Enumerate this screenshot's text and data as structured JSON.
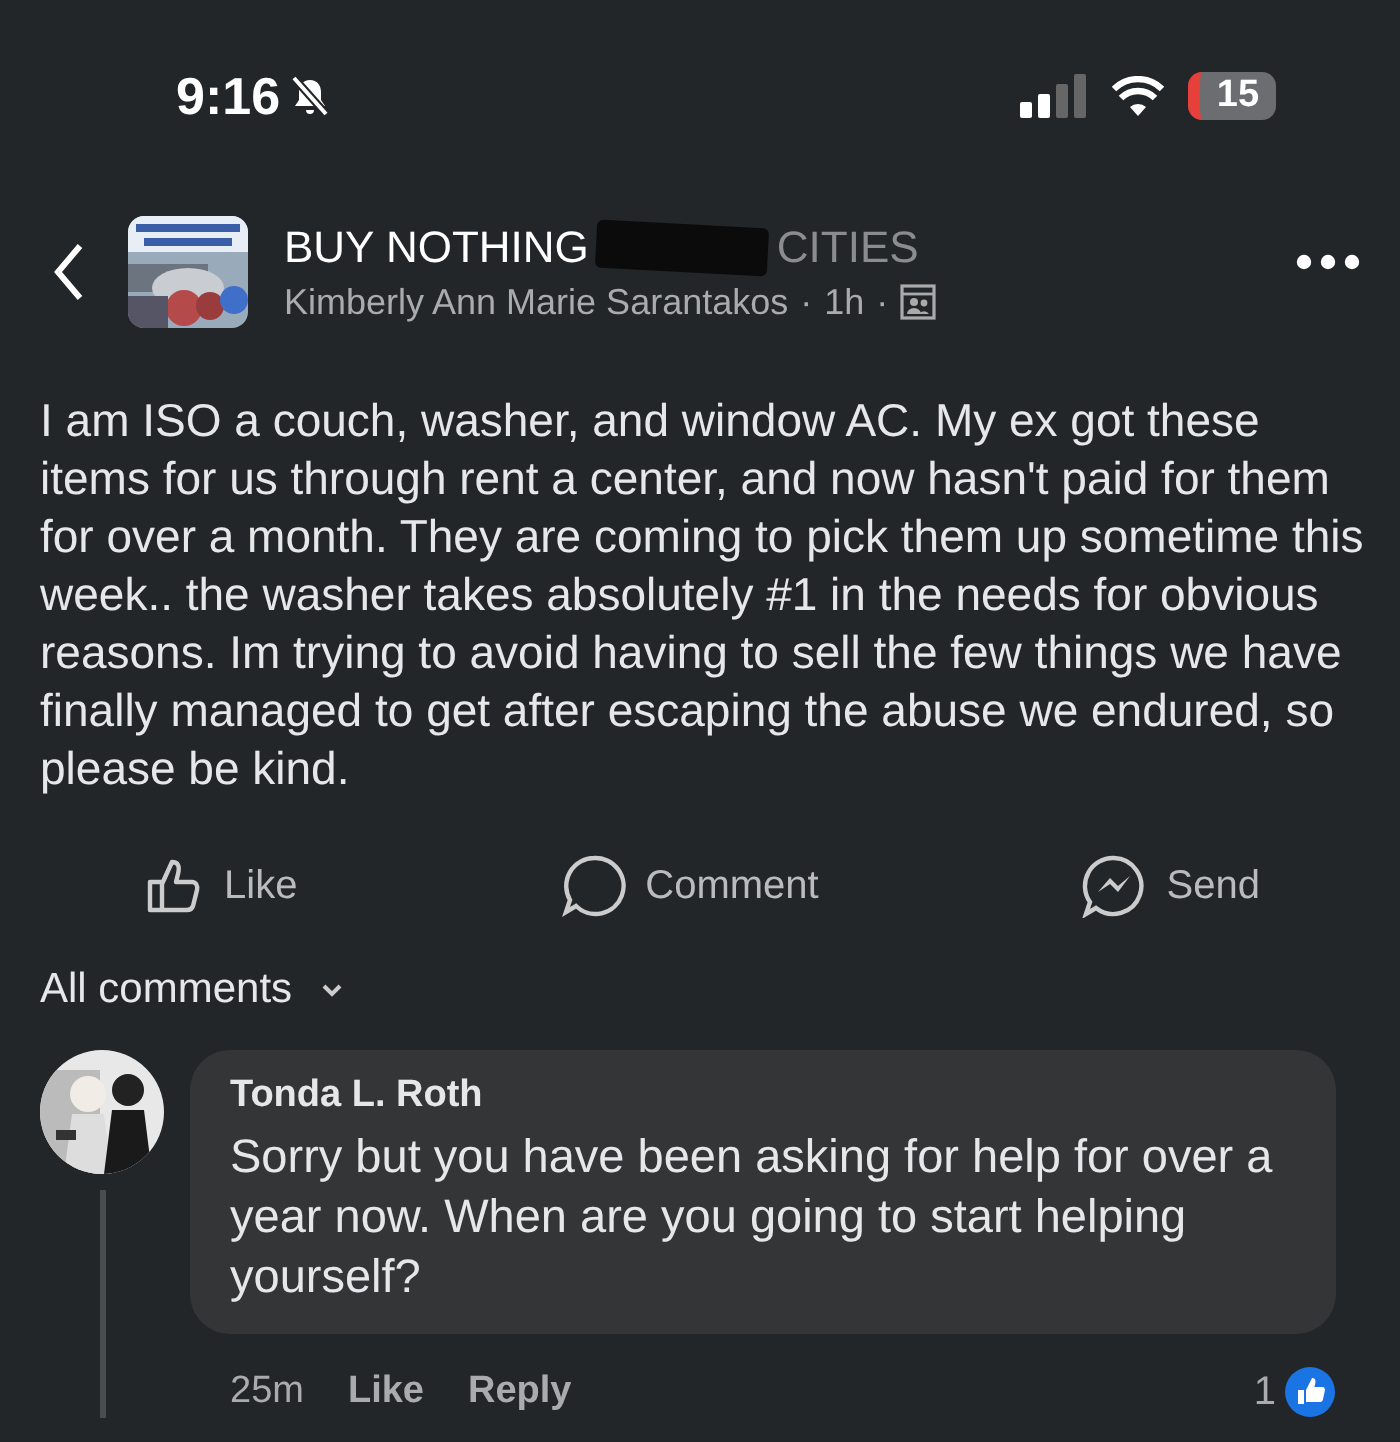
{
  "status_bar": {
    "time": "9:16",
    "silent": true,
    "battery": "15"
  },
  "header": {
    "group_name": "BUY NOTHING",
    "group_name_tail": "CITIES",
    "author": "Kimberly Ann Marie Sarantakos",
    "separator": "·",
    "age": "1h",
    "redacted": true
  },
  "post": {
    "text": "I am ISO a couch, washer, and window AC. My ex got these items for us through rent a center, and now hasn't paid for them for over a month. They are coming to pick them up sometime this week.. the washer takes absolutely #1 in the needs for obvious reasons. Im trying to avoid having to sell the few things we have finally managed to get after escaping the abuse we endured, so please be kind."
  },
  "actions": [
    {
      "kind": "like",
      "label": "Like"
    },
    {
      "kind": "comment",
      "label": "Comment"
    },
    {
      "kind": "send",
      "label": "Send"
    }
  ],
  "comments_filter": "All comments",
  "comments": [
    {
      "author": "Tonda L. Roth",
      "text": "Sorry but you have been asking for help for over a year now. When are you going to start helping yourself?",
      "age": "25m",
      "like": "Like",
      "reply": "Reply",
      "reactions": "1"
    }
  ]
}
